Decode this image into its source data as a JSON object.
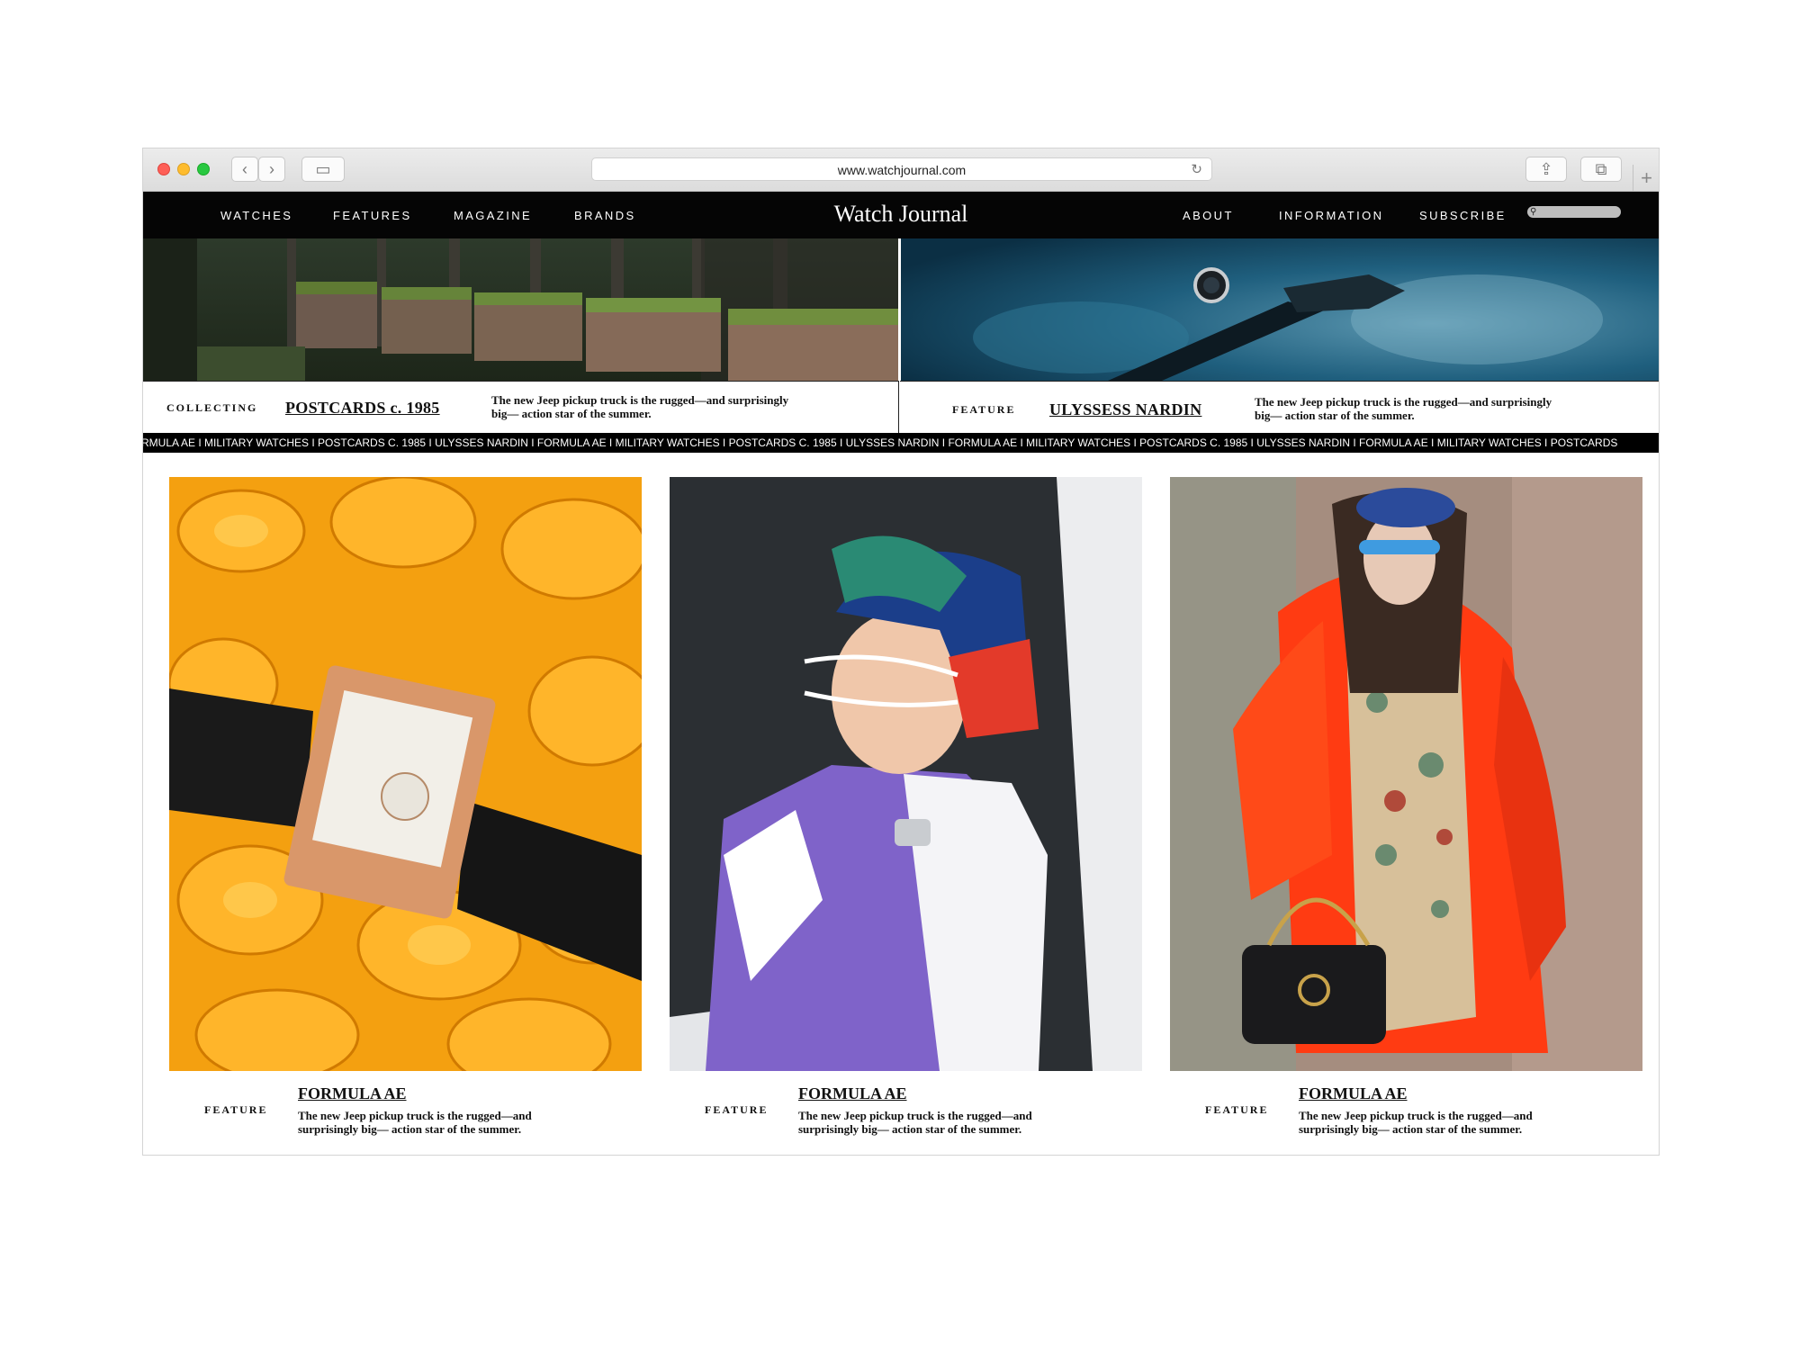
{
  "browser": {
    "url": "www.watchjournal.com",
    "back_icon": "‹",
    "forward_icon": "›",
    "sidebar_icon": "▭",
    "share_icon": "⇪",
    "tabs_icon": "⧉",
    "reload_icon": "↻",
    "newtab_icon": "+"
  },
  "nav": {
    "left": [
      "WATCHES",
      "FEATURES",
      "MAGAZINE",
      "BRANDS"
    ],
    "brand": "Watch Journal",
    "right": [
      "ABOUT",
      "INFORMATION",
      "SUBSCRIBE"
    ],
    "search_icon": "⚲"
  },
  "hero": [
    {
      "category": "COLLECTING",
      "title": "POSTCARDS c. 1985",
      "blurb_line1": "The new Jeep pickup truck is the rugged—and surprisingly",
      "blurb_line2": "big— action star of the summer."
    },
    {
      "category": "FEATURE",
      "title": "ULYSSESS NARDIN",
      "blurb_line1": "The new Jeep pickup truck is the rugged—and surprisingly",
      "blurb_line2": "big— action star of the summer."
    }
  ],
  "ticker": "RMULA AE I MILITARY WATCHES I POSTCARDS C. 1985 I ULYSSES NARDIN I FORMULA AE I MILITARY WATCHES I POSTCARDS C. 1985 I ULYSSES NARDIN I FORMULA AE I MILITARY WATCHES I POSTCARDS C. 1985 I ULYSSES NARDIN I FORMULA AE I MILITARY WATCHES I POSTCARDS",
  "cards": [
    {
      "category": "FEATURE",
      "title": "FORMULA AE",
      "blurb_line1": "The new Jeep pickup truck is the rugged—and",
      "blurb_line2": "surprisingly big— action star of the summer."
    },
    {
      "category": "FEATURE",
      "title": "FORMULA AE",
      "blurb_line1": "The new Jeep pickup truck is the rugged—and",
      "blurb_line2": "surprisingly big— action star of the summer."
    },
    {
      "category": "FEATURE",
      "title": "FORMULA AE",
      "blurb_line1": "The new Jeep pickup truck is the rugged—and",
      "blurb_line2": "surprisingly big— action star of the summer."
    }
  ],
  "colors": {
    "nav_bg": "#050505",
    "ticker_bg": "#000000",
    "accent_orange": "#f5a40a",
    "accent_red": "#ff3b12"
  }
}
